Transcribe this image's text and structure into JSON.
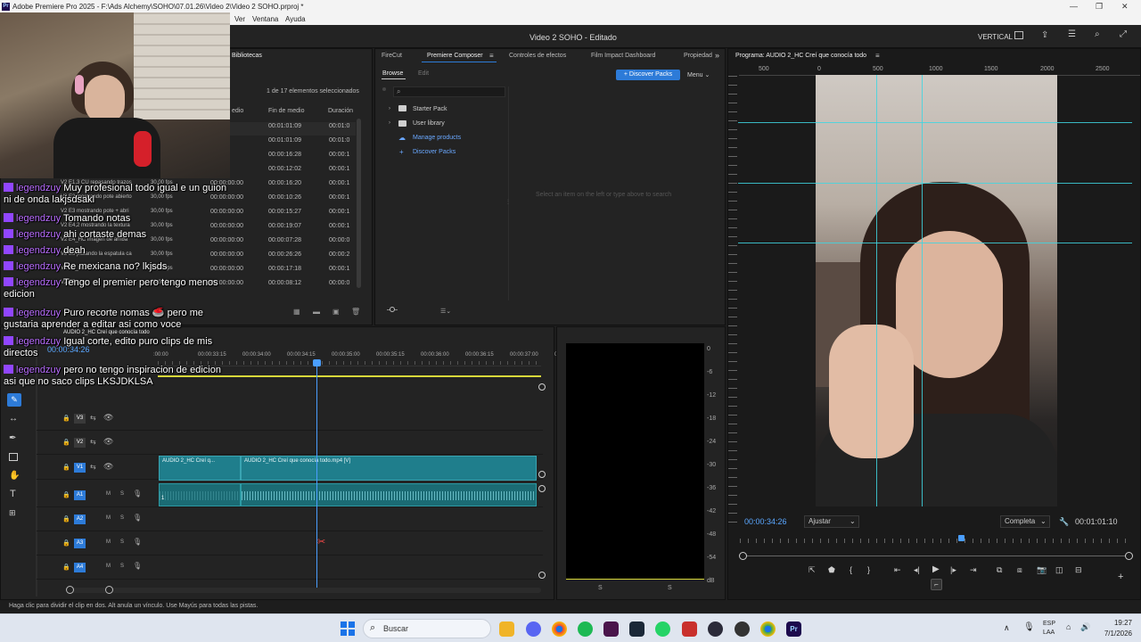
{
  "window": {
    "title": "Adobe Premiere Pro 2025 - F:\\Ads Alchemy\\SOHO\\07.01.26\\Video 2\\Video 2 SOHO.prproj *",
    "logo": "Pr"
  },
  "menu": [
    "Ver",
    "Ventana",
    "Ayuda"
  ],
  "appbar": {
    "project_title": "Video 2 SOHO - Editado",
    "workspace": "VERTICAL"
  },
  "project_panel": {
    "tab": "Bibliotecas",
    "selection_info": "1 de 17 elementos seleccionados",
    "columns": [
      "edio",
      "Fin de medio",
      "Duración"
    ],
    "rows": [
      {
        "name": "",
        "fps": "",
        "start": "00",
        "end": "00:01:01:09",
        "dur": "00:01:0"
      },
      {
        "name": "",
        "fps": "",
        "start": "00",
        "end": "00:01:01:09",
        "dur": "00:01:0"
      },
      {
        "name": "",
        "fps": "",
        "start": "00",
        "end": "00:00:16:28",
        "dur": "00:00:1"
      },
      {
        "name": "",
        "fps": "",
        "start": "00",
        "end": "00:00:12:02",
        "dur": "00:00:1"
      },
      {
        "name": "V2 E1,3 CU repasando trazos",
        "fps": "30,00 fps",
        "start": "00:00:00:00",
        "end": "00:00:16:20",
        "dur": "00:00:1"
      },
      {
        "name": "V2 E2 mostrando pote abierto",
        "fps": "30,00 fps",
        "start": "00:00:00:00",
        "end": "00:00:10:26",
        "dur": "00:00:1"
      },
      {
        "name": "V2 E3 mostrando pote + abri",
        "fps": "30,00 fps",
        "start": "00:00:00:00",
        "end": "00:00:15:27",
        "dur": "00:00:1"
      },
      {
        "name": "V2 E4,2 mostrando la textura",
        "fps": "30,00 fps",
        "start": "00:00:00:00",
        "end": "00:00:19:07",
        "dur": "00:00:1"
      },
      {
        "name": "V2 E4_HC imagen de arriba",
        "fps": "30,00 fps",
        "start": "00:00:00:00",
        "end": "00:00:07:28",
        "dur": "00:00:0"
      },
      {
        "name": "V2 E5 pasando la espatula ca",
        "fps": "30,00 fps",
        "start": "00:00:00:00",
        "end": "00:00:26:26",
        "dur": "00:00:2"
      },
      {
        "name": "V2 E5_HC",
        "fps": "30,00 fps",
        "start": "00:00:00:00",
        "end": "00:00:17:18",
        "dur": "00:00:1"
      },
      {
        "name": "V2 E5",
        "fps": "30,00 fps",
        "start": "00:00:00:00",
        "end": "00:00:08:12",
        "dur": "00:00:0"
      }
    ]
  },
  "composer_panel": {
    "tabs": [
      "FireCut",
      "Premiere Composer",
      "Controles de efectos",
      "Film Impact Dashboard",
      "Propiedad"
    ],
    "subtabs": [
      "Browse",
      "Edit"
    ],
    "discover_button": "+ Discover Packs",
    "menu_label": "Menu",
    "search_placeholder": "",
    "tree": [
      "Starter Pack",
      "User library",
      "Manage products",
      "Discover Packs"
    ],
    "empty_hint": "Select an item on the left or type above to search"
  },
  "timeline": {
    "tab": "AUDIO 2_HC Creí que conocía todo",
    "timecode": "00:00:34:26",
    "ruler": [
      ":00:00",
      "00:00:33:15",
      "00:00:34:00",
      "00:00:34:15",
      "00:00:35:00",
      "00:00:35:15",
      "00:00:36:00",
      "00:00:36:15",
      "00:00:37:00",
      "00:0"
    ],
    "tracks": [
      "V3",
      "V2",
      "V1",
      "A1",
      "A2",
      "A3",
      "A4"
    ],
    "clip_v1_a": "AUDIO 2_HC Creí q...",
    "clip_v1_b": "AUDIO 2_HC Creí que conocía todo.mp4 [V]",
    "mute_label": "M",
    "solo_label": "S",
    "audio_marker": "1"
  },
  "meter": {
    "scale": [
      "0",
      "-6",
      "-12",
      "-18",
      "-24",
      "-30",
      "-36",
      "-42",
      "-48",
      "-54",
      "dB"
    ],
    "bottom": [
      "S",
      "S"
    ]
  },
  "program": {
    "title": "Programa: AUDIO 2_HC Creí que conocía todo",
    "ruler": [
      "500",
      "0",
      "500",
      "1000",
      "1500",
      "2000",
      "2500"
    ],
    "timecode": "00:00:34:26",
    "fit": "Ajustar",
    "quality": "Completa",
    "duration": "00:01:01:10"
  },
  "chat": [
    {
      "user": "legendzuy",
      "msg": "Muy profesional todo igual e un guion ni de onda lakjsdsakl"
    },
    {
      "user": "legendzuy",
      "msg": "Tomando notas"
    },
    {
      "user": "legendzuy",
      "msg": "ahi cortaste demas"
    },
    {
      "user": "legendzuy",
      "msg": "deah"
    },
    {
      "user": "legendzuy",
      "msg": "Re mexicana no? lkjsds"
    },
    {
      "user": "legendzuy",
      "msg": "Tengo el premier pero tengo menos edicion"
    },
    {
      "user": "legendzuy",
      "msg": "Puro recorte nomas 🥌 pero me gustaria aprender a editar asi como voce"
    },
    {
      "user": "legendzuy",
      "msg": "Igual corte, edito puro clips de mis directos"
    },
    {
      "user": "legendzuy",
      "msg": "pero no tengo inspiracion de edicion asi que no saco clips LKSJDKLSA"
    }
  ],
  "status_bar": "Haga clic para dividir el clip en dos. Alt anula un vínculo. Use Mayús para todas las pistas.",
  "taskbar": {
    "search": "Buscar",
    "lang1": "ESP",
    "lang2": "LAA",
    "time": "19:27",
    "date": "7/1/2026"
  },
  "colors": {
    "accent": "#2d7bd8",
    "clip": "#1f7e8c",
    "playhead": "#4a9eff",
    "guide": "#3fd5e0"
  }
}
